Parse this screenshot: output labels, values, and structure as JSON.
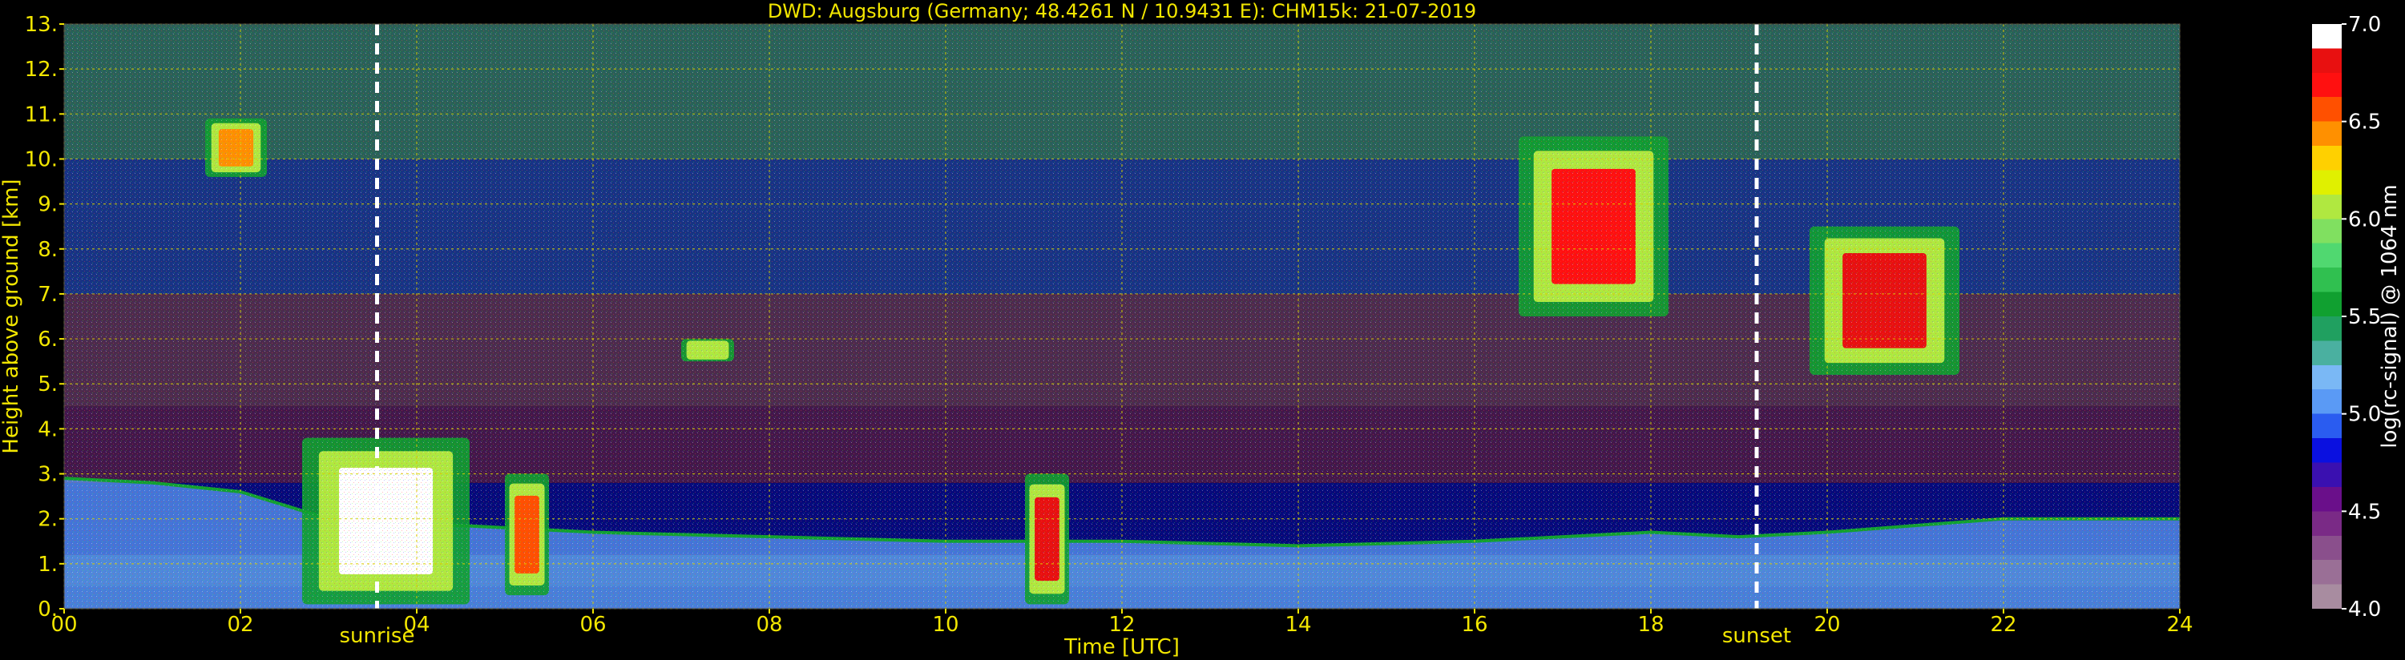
{
  "chart_data": {
    "type": "heatmap",
    "title": "DWD: Augsburg (Germany; 48.4261 N / 10.9431 E):    CHM15k: 21-07-2019",
    "xlabel": "Time [UTC]",
    "ylabel": "Height above ground [km]",
    "xlim": [
      0,
      24
    ],
    "ylim": [
      0,
      13
    ],
    "x_ticks": [
      "00",
      "02",
      "04",
      "06",
      "08",
      "10",
      "12",
      "14",
      "16",
      "18",
      "20",
      "22",
      "24"
    ],
    "x_tick_values": [
      0,
      2,
      4,
      6,
      8,
      10,
      12,
      14,
      16,
      18,
      20,
      22,
      24
    ],
    "y_ticks": [
      "0.",
      "1.",
      "2.",
      "3.",
      "4.",
      "5.",
      "6.",
      "7.",
      "8.",
      "9.",
      "10.",
      "11.",
      "12.",
      "13."
    ],
    "y_tick_values": [
      0,
      1,
      2,
      3,
      4,
      5,
      6,
      7,
      8,
      9,
      10,
      11,
      12,
      13
    ],
    "grid": true,
    "annotations": [
      {
        "label": "sunrise",
        "time": 3.55
      },
      {
        "label": "sunset",
        "time": 19.2
      }
    ],
    "colorbar": {
      "label": "log(rc-signal) @ 1064 nm",
      "range": [
        4.0,
        7.0
      ],
      "ticks": [
        "4.0",
        "4.5",
        "5.0",
        "5.5",
        "6.0",
        "6.5",
        "7.0"
      ],
      "tick_values": [
        4.0,
        4.5,
        5.0,
        5.5,
        6.0,
        6.5,
        7.0
      ],
      "colors": [
        "#a88ca0",
        "#9a6f96",
        "#8a4f8c",
        "#7a2a86",
        "#6a0f8a",
        "#3a10b0",
        "#0a10e0",
        "#2a5cf0",
        "#5a9af5",
        "#7ab8f5",
        "#4ab0a0",
        "#20a060",
        "#10a030",
        "#30c050",
        "#50d870",
        "#80e060",
        "#b0e840",
        "#e0f000",
        "#ffd000",
        "#ff9000",
        "#ff5000",
        "#ff1010",
        "#e81010",
        "#ffffff"
      ]
    },
    "features": [
      {
        "kind": "boundary-layer",
        "value": 5.0,
        "points": [
          [
            0,
            2.9
          ],
          [
            1,
            2.8
          ],
          [
            2,
            2.6
          ],
          [
            3,
            2.0
          ],
          [
            4,
            1.9
          ],
          [
            5,
            1.8
          ],
          [
            6,
            1.7
          ],
          [
            8,
            1.6
          ],
          [
            10,
            1.5
          ],
          [
            12,
            1.5
          ],
          [
            14,
            1.4
          ],
          [
            16,
            1.5
          ],
          [
            18,
            1.7
          ],
          [
            19,
            1.6
          ],
          [
            20,
            1.7
          ],
          [
            22,
            2.0
          ],
          [
            24,
            2.0
          ]
        ]
      },
      {
        "kind": "cloud",
        "t0": 2.7,
        "t1": 4.6,
        "h0": 0.1,
        "h1": 3.8,
        "value": 6.9
      },
      {
        "kind": "cloud",
        "t0": 5.0,
        "t1": 5.5,
        "h0": 0.3,
        "h1": 3.0,
        "value": 6.6
      },
      {
        "kind": "cloud",
        "t0": 10.9,
        "t1": 11.4,
        "h0": 0.1,
        "h1": 3.0,
        "value": 6.8
      },
      {
        "kind": "cloud",
        "t0": 1.6,
        "t1": 2.3,
        "h0": 9.6,
        "h1": 10.9,
        "value": 6.4
      },
      {
        "kind": "cloud",
        "t0": 16.5,
        "t1": 18.2,
        "h0": 6.5,
        "h1": 10.5,
        "value": 6.7
      },
      {
        "kind": "cloud",
        "t0": 19.8,
        "t1": 21.5,
        "h0": 5.2,
        "h1": 8.5,
        "value": 6.8
      },
      {
        "kind": "cloud",
        "t0": 7.0,
        "t1": 7.6,
        "h0": 5.5,
        "h1": 6.0,
        "value": 6.0
      }
    ]
  }
}
